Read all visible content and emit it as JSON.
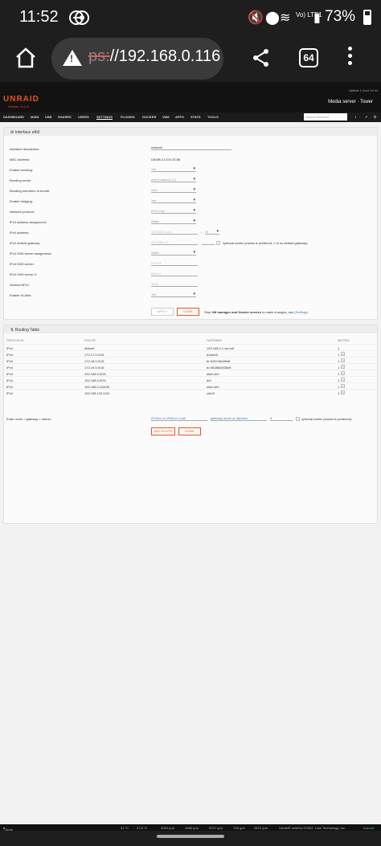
{
  "status_bar": {
    "time": "11:52",
    "battery": "73%",
    "network": "Vo) LTE1"
  },
  "browser": {
    "url_protocol": "ps:",
    "url_host": "//192.168.0.116",
    "tab_count": "64"
  },
  "header": {
    "logo": "UNRAID",
    "version": "Version: 6.11.5",
    "uptime": "Uptime 1 hour 24 mi",
    "server": "Media server · Tower"
  },
  "nav": {
    "items": [
      "DASHBOARD",
      "MAIN",
      "USB",
      "SHARES",
      "USERS",
      "SETTINGS",
      "PLUGINS",
      "DOCKER",
      "VMS",
      "APPS",
      "STATS",
      "TOOLS"
    ],
    "search_placeholder": "Search WebGUI"
  },
  "interface": {
    "title": "Interface eth0",
    "fields": [
      {
        "label": "Interface description:",
        "value": "network"
      },
      {
        "label": "MAC address:",
        "value": "D8:BB:C1:D3:CE:85"
      },
      {
        "label": "Enable bonding:",
        "value": "Yes"
      },
      {
        "label": "Bonding mode:",
        "value": "active-backup (1)"
      },
      {
        "label": "Bonding members of bond0:",
        "value": "eth0"
      },
      {
        "label": "Enable bridging:",
        "value": "Yes"
      },
      {
        "label": "Network protocol:",
        "value": "IPv4 only"
      },
      {
        "label": "IPv4 address assignment:",
        "value": "Static"
      },
      {
        "label": "IPv4 address:",
        "value": "192.168.0.116"
      },
      {
        "label": "IPv4 default gateway:",
        "value": "192.168.0.1"
      },
      {
        "label": "IPv4 DNS server assignment:",
        "value": "Static"
      },
      {
        "label": "IPv4 DNS server:",
        "value": "9.9.9.9"
      },
      {
        "label": "IPv4 DNS server 2:",
        "value": "8.8.4.4"
      },
      {
        "label": "Desired MTU:",
        "value": "1500"
      },
      {
        "label": "Enable VLANs:",
        "value": "Yes"
      }
    ],
    "prefix": "24",
    "metric_note": "optional metric (lowest is preferred, 0 is no default gateway)",
    "apply_label": "APPLY",
    "done_label": "DONE",
    "stop_note_pre": "Stop",
    "stop_note_bold": "VM manager and Docker service",
    "stop_note_post": "to make changes, see",
    "stop_note_link": "(Settings)"
  },
  "routing": {
    "title": "Routing Table",
    "columns": [
      "PROTOCOL",
      "ROUTE",
      "GATEWAY",
      "METRIC"
    ],
    "rows": [
      {
        "protocol": "IPv4",
        "route": "default",
        "gateway": "192.168.0.1 via br0",
        "metric": "1"
      },
      {
        "protocol": "IPv4",
        "route": "172.17.0.0/16",
        "gateway": "docker0",
        "metric": "1"
      },
      {
        "protocol": "IPv4",
        "route": "172.18.0.0/16",
        "gateway": "br-515746d9fe6f",
        "metric": "1"
      },
      {
        "protocol": "IPv4",
        "route": "172.19.0.0/16",
        "gateway": "br-9628640f3b05",
        "metric": "1"
      },
      {
        "protocol": "IPv4",
        "route": "192.168.0.0/25",
        "gateway": "shim-br0",
        "metric": "1"
      },
      {
        "protocol": "IPv4",
        "route": "192.168.0.0/24",
        "gateway": "br0",
        "metric": "1"
      },
      {
        "protocol": "IPv4",
        "route": "192.168.0.128/25",
        "gateway": "shim-br0",
        "metric": "1"
      },
      {
        "protocol": "IPv4",
        "route": "192.168.122.0/24",
        "gateway": "virbr0",
        "metric": "1"
      }
    ],
    "enter_label": "Enter route + gateway + metric:",
    "route_placeholder": "IPv4/nn or IPv6/nn route",
    "gateway_placeholder": "gateway name or address",
    "metric_value": "1",
    "metric_note": "optional metric (lowest is preferred)",
    "add_label": "ADD ROUTE",
    "done_label": "DONE"
  },
  "footer": {
    "array": "Array Started",
    "temps": [
      "31 °C",
      "27.8 °C"
    ],
    "fans": [
      "2054 rpm",
      "4956 rpm",
      "5707 rpm",
      "738 rpm",
      "2872 rpm"
    ],
    "copyright": "Unraid® webGui ©2022, Lime Technology, Inc.",
    "manual": "manual"
  }
}
